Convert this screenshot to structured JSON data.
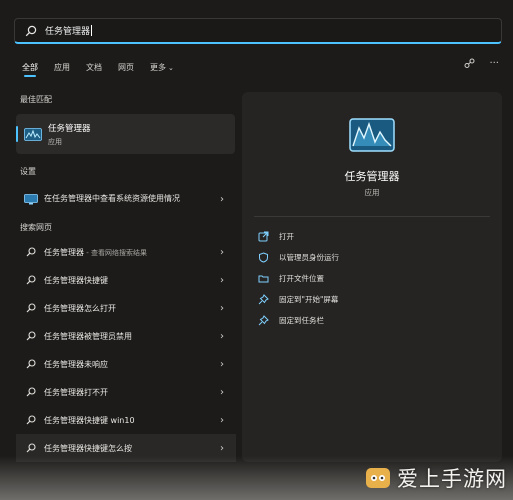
{
  "search": {
    "value": "任务管理器"
  },
  "filters": {
    "all": "全部",
    "apps": "应用",
    "docs": "文档",
    "web": "网页",
    "more": "更多"
  },
  "best_match": {
    "title": "最佳匹配",
    "name": "任务管理器",
    "type": "应用"
  },
  "settings": {
    "title": "设置",
    "item": "在任务管理器中查看系统资源使用情况"
  },
  "web_search": {
    "title": "搜索网页",
    "items": [
      {
        "text": "任务管理器",
        "suffix": " - 查看网络搜索结果"
      },
      {
        "text": "任务管理器快捷键",
        "suffix": ""
      },
      {
        "text": "任务管理器怎么打开",
        "suffix": ""
      },
      {
        "text": "任务管理器被管理员禁用",
        "suffix": ""
      },
      {
        "text": "任务管理器未响应",
        "suffix": ""
      },
      {
        "text": "任务管理器打不开",
        "suffix": ""
      },
      {
        "text": "任务管理器快捷键 win10",
        "suffix": ""
      },
      {
        "text": "任务管理器快捷键怎么按",
        "suffix": ""
      }
    ]
  },
  "preview": {
    "name": "任务管理器",
    "type": "应用",
    "actions": [
      {
        "label": "打开",
        "icon": "open-icon"
      },
      {
        "label": "以管理员身份运行",
        "icon": "run-as-admin-icon"
      },
      {
        "label": "打开文件位置",
        "icon": "folder-icon"
      },
      {
        "label": "固定到\"开始\"屏幕",
        "icon": "pin-icon"
      },
      {
        "label": "固定到任务栏",
        "icon": "pin-icon"
      }
    ]
  },
  "watermark": {
    "text": "爱上手游网"
  },
  "colors": {
    "accent": "#4cc2ff",
    "background": "#1d1b19",
    "panel": "#262422"
  }
}
